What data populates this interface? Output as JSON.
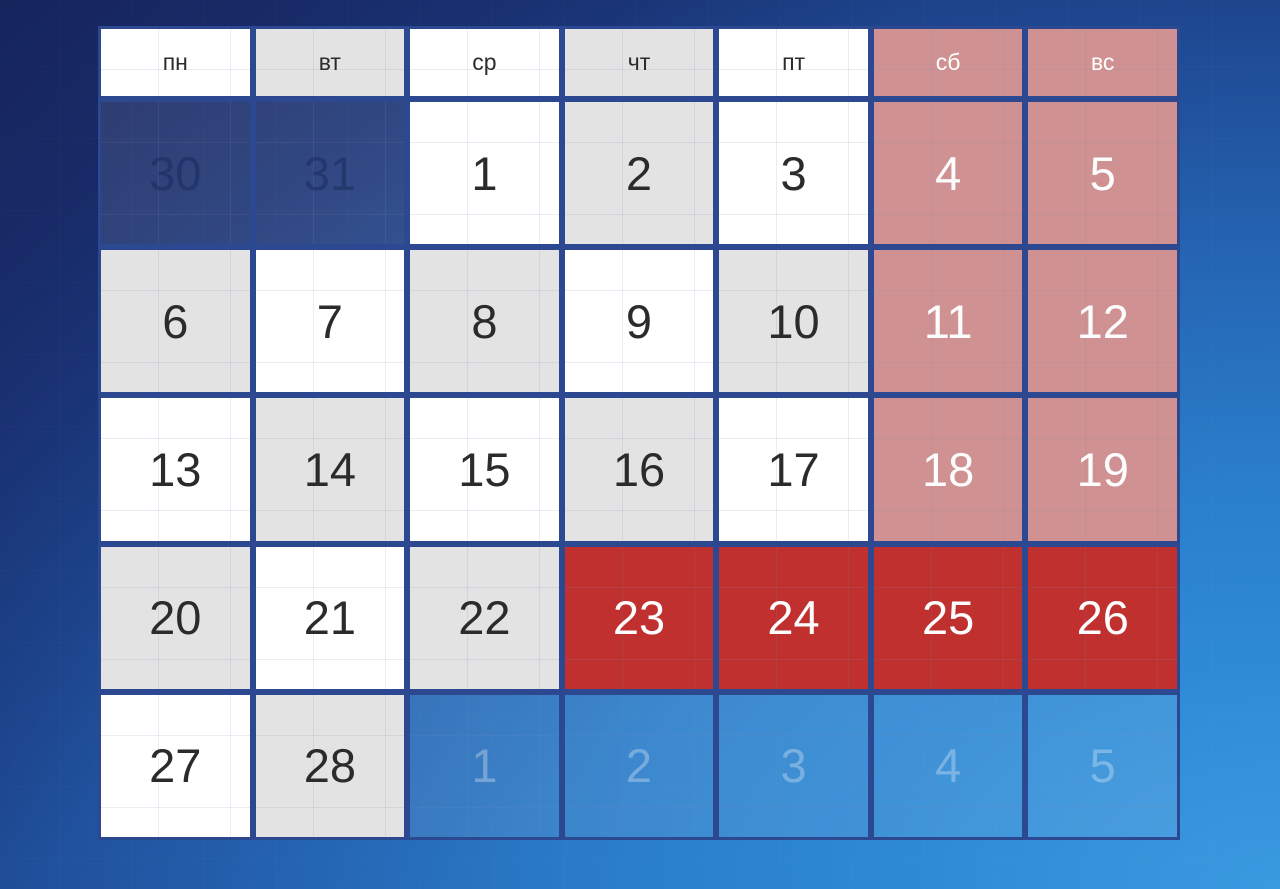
{
  "calendar": {
    "locale": "ru",
    "weekday_headers": [
      {
        "label": "пн",
        "kind": "white"
      },
      {
        "label": "вт",
        "kind": "gray"
      },
      {
        "label": "ср",
        "kind": "white"
      },
      {
        "label": "чт",
        "kind": "gray"
      },
      {
        "label": "пт",
        "kind": "white"
      },
      {
        "label": "сб",
        "kind": "pink"
      },
      {
        "label": "вс",
        "kind": "pink"
      }
    ],
    "weeks": [
      [
        {
          "day": "30",
          "kind": "out-prev"
        },
        {
          "day": "31",
          "kind": "out-prev"
        },
        {
          "day": "1",
          "kind": "white"
        },
        {
          "day": "2",
          "kind": "gray"
        },
        {
          "day": "3",
          "kind": "white"
        },
        {
          "day": "4",
          "kind": "pink"
        },
        {
          "day": "5",
          "kind": "pink"
        }
      ],
      [
        {
          "day": "6",
          "kind": "gray"
        },
        {
          "day": "7",
          "kind": "white"
        },
        {
          "day": "8",
          "kind": "gray"
        },
        {
          "day": "9",
          "kind": "white"
        },
        {
          "day": "10",
          "kind": "gray"
        },
        {
          "day": "11",
          "kind": "pink"
        },
        {
          "day": "12",
          "kind": "pink"
        }
      ],
      [
        {
          "day": "13",
          "kind": "white"
        },
        {
          "day": "14",
          "kind": "gray"
        },
        {
          "day": "15",
          "kind": "white"
        },
        {
          "day": "16",
          "kind": "gray"
        },
        {
          "day": "17",
          "kind": "white"
        },
        {
          "day": "18",
          "kind": "pink"
        },
        {
          "day": "19",
          "kind": "pink"
        }
      ],
      [
        {
          "day": "20",
          "kind": "gray"
        },
        {
          "day": "21",
          "kind": "white"
        },
        {
          "day": "22",
          "kind": "gray"
        },
        {
          "day": "23",
          "kind": "red"
        },
        {
          "day": "24",
          "kind": "red"
        },
        {
          "day": "25",
          "kind": "red"
        },
        {
          "day": "26",
          "kind": "red"
        }
      ],
      [
        {
          "day": "27",
          "kind": "white"
        },
        {
          "day": "28",
          "kind": "gray"
        },
        {
          "day": "1",
          "kind": "out-next"
        },
        {
          "day": "2",
          "kind": "out-next"
        },
        {
          "day": "3",
          "kind": "out-next"
        },
        {
          "day": "4",
          "kind": "out-next"
        },
        {
          "day": "5",
          "kind": "out-next"
        }
      ]
    ],
    "colors": {
      "grid_border": "#2b4891",
      "weekday_cell": "#ffffff",
      "weekday_cell_alt": "#e3e3e3",
      "weekend_cell": "#cf9191",
      "holiday_cell": "#c0302f",
      "day_text": "#2b2b2b",
      "weekend_text": "#fdfdfd",
      "background_dark": "#1a2a63",
      "background_light": "#3a9ae0"
    }
  }
}
